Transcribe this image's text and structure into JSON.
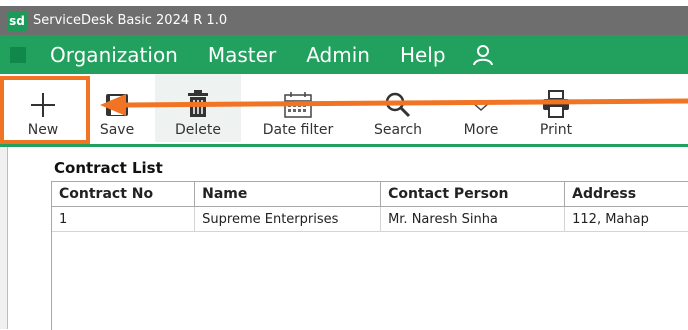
{
  "app": {
    "logo": "sd",
    "title": "ServiceDesk Basic 2024 R 1.0"
  },
  "menu": {
    "items": [
      "Organization",
      "Master",
      "Admin",
      "Help"
    ],
    "user_icon": "user-icon"
  },
  "toolbar": {
    "new": "New",
    "save": "Save",
    "delete": "Delete",
    "date_filter": "Date filter",
    "search": "Search",
    "more": "More",
    "print": "Print"
  },
  "annotation": {
    "color": "#f07424"
  },
  "colors": {
    "accent_green": "#21a05e",
    "titlebar": "#6e6e6e"
  },
  "contract_list": {
    "title": "Contract List",
    "columns": [
      "Contract No",
      "Name",
      "Contact Person",
      "Address"
    ],
    "rows": [
      [
        "1",
        "Supreme Enterprises",
        "Mr. Naresh Sinha",
        "112, Mahap"
      ]
    ]
  }
}
